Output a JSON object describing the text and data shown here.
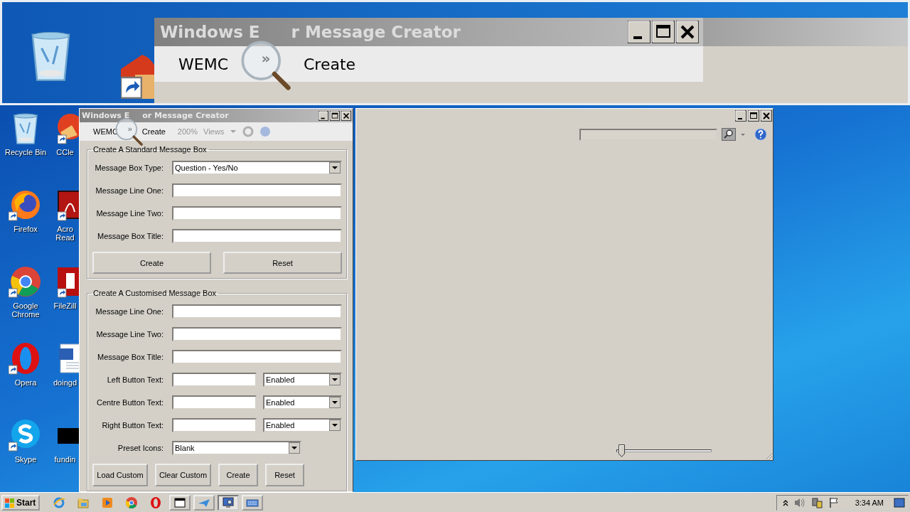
{
  "magnifier_view": {
    "title_parts": [
      "Windows E",
      "r Message Creator"
    ],
    "menu": [
      "WEMC",
      "»",
      "Create"
    ]
  },
  "desktop_icons": [
    {
      "kind": "recycle",
      "label": "Recycle Bin"
    },
    {
      "kind": "firefox",
      "label": "Firefox"
    },
    {
      "kind": "chrome",
      "label": "Google Chrome"
    },
    {
      "kind": "opera",
      "label": "Opera"
    },
    {
      "kind": "skype",
      "label": "Skype"
    }
  ],
  "desktop_icons_partial": [
    {
      "kind": "ccleaner",
      "label": "CCle"
    },
    {
      "kind": "acrobat",
      "label": "Acro Read"
    },
    {
      "kind": "filezilla",
      "label": "FileZill"
    },
    {
      "kind": "word",
      "label": "doingd"
    },
    {
      "kind": "black",
      "label": "fundin"
    }
  ],
  "wemc_window": {
    "title_parts": [
      "Windows E",
      "or Message Creator"
    ],
    "menu": [
      "WEMC",
      "»",
      "Create"
    ],
    "magnifier_toolbar": {
      "zoom": "200%",
      "views": "Views"
    },
    "standard_group": {
      "legend": "Create A Standard Message Box",
      "rows": [
        {
          "kind": "select",
          "label": "Message Box Type:",
          "value": "Question - Yes/No"
        },
        {
          "kind": "text",
          "label": "Message Line One:"
        },
        {
          "kind": "text",
          "label": "Message Line Two:"
        },
        {
          "kind": "text",
          "label": "Message Box Title:"
        }
      ],
      "buttons": [
        "Create",
        "Reset"
      ]
    },
    "custom_group": {
      "legend": "Create A Customised Message Box",
      "rows": [
        {
          "kind": "text",
          "label": "Message Line One:"
        },
        {
          "kind": "text",
          "label": "Message Line Two:"
        },
        {
          "kind": "text",
          "label": "Message Box Title:"
        },
        {
          "kind": "text_select",
          "label": "Left Button Text:",
          "value": "Enabled"
        },
        {
          "kind": "text_select",
          "label": "Centre Button Text:",
          "value": "Enabled"
        },
        {
          "kind": "text_select",
          "label": "Right Button Text:",
          "value": "Enabled"
        },
        {
          "kind": "short_select",
          "label": "Preset Icons:",
          "value": "Blank"
        }
      ],
      "buttons": [
        "Load Custom",
        "Clear Custom",
        "Create",
        "Reset"
      ]
    }
  },
  "magnifier_window": {
    "slider": {
      "level": 0.02
    }
  },
  "taskbar": {
    "start": "Start",
    "items": [
      {
        "kind": "ie",
        "running": false,
        "selected": false
      },
      {
        "kind": "folder",
        "running": false,
        "selected": false
      },
      {
        "kind": "media",
        "running": false,
        "selected": false
      },
      {
        "kind": "chrome",
        "running": false,
        "selected": false
      },
      {
        "kind": "opera",
        "running": false,
        "selected": false
      },
      {
        "kind": "window",
        "running": true,
        "selected": false
      },
      {
        "kind": "plane",
        "running": true,
        "selected": false
      },
      {
        "kind": "magnifier",
        "running": true,
        "selected": true
      },
      {
        "kind": "keyboard",
        "running": true,
        "selected": false
      }
    ],
    "clock": "3:34 AM"
  }
}
